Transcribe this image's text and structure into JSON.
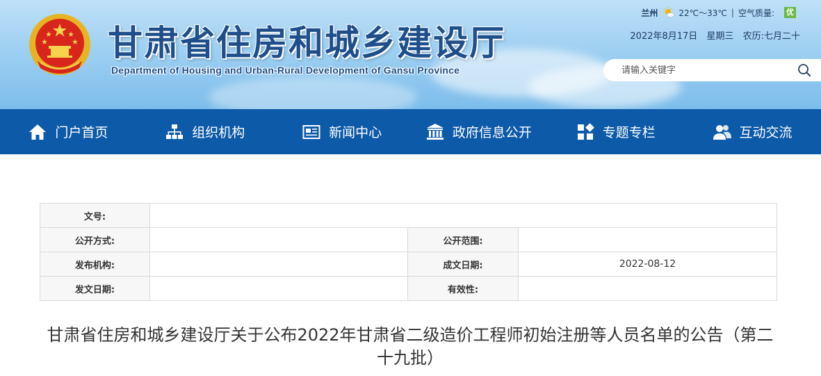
{
  "header": {
    "title": "甘肃省住房和城乡建设厅",
    "subtitle": "Department of Housing and Urban-Rural Development of Gansu Province",
    "emblem_icon": "national-emblem-icon"
  },
  "weather": {
    "city": "兰州",
    "icon": "partly-sunny-icon",
    "temperature": "22℃～33℃",
    "separator": "|",
    "air_quality_label": "空气质量:",
    "air_quality_value": "优",
    "air_quality_color": "#6ab842"
  },
  "date": {
    "gregorian": "2022年8月17日",
    "weekday": "星期三",
    "lunar": "农历:七月二十"
  },
  "search": {
    "placeholder": "请输入关键字",
    "value": "",
    "icon": "search-icon"
  },
  "nav": {
    "background": "#0d5aa8",
    "items": [
      {
        "label": "门户首页",
        "icon": "home-icon"
      },
      {
        "label": "组织机构",
        "icon": "org-chart-icon"
      },
      {
        "label": "新闻中心",
        "icon": "newspaper-icon"
      },
      {
        "label": "政府信息公开",
        "icon": "government-building-icon"
      },
      {
        "label": "专题专栏",
        "icon": "grid-icon"
      },
      {
        "label": "互动交流",
        "icon": "users-icon"
      }
    ]
  },
  "info": {
    "doc_no_label": "文号:",
    "doc_no_value": "",
    "disclosure_method_label": "公开方式:",
    "disclosure_method_value": "",
    "disclosure_scope_label": "公开范围:",
    "disclosure_scope_value": "",
    "issuer_label": "发布机构:",
    "issuer_value": "",
    "creation_date_label": "成文日期:",
    "creation_date_value": "2022-08-12",
    "issue_date_label": "发文日期:",
    "issue_date_value": "",
    "validity_label": "有效性:",
    "validity_value": ""
  },
  "article": {
    "title": "甘肃省住房和城乡建设厅关于公布2022年甘肃省二级造价工程师初始注册等人员名单的公告（第二十九批）"
  }
}
